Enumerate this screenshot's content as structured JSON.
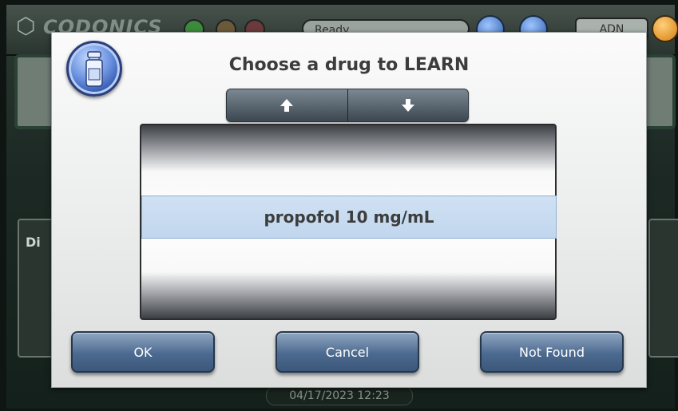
{
  "background": {
    "logo": "CODONICS",
    "status": "Ready",
    "user": "ADN",
    "panel_label": "Di",
    "datetime": "04/17/2023 12:23"
  },
  "dialog": {
    "icon": "vial-icon",
    "title": "Choose a drug to LEARN",
    "scroll_up_label": "🡑",
    "scroll_down_label": "🡓",
    "items": [
      "",
      "propofol 10 mg/mL",
      ""
    ],
    "selected_item": "propofol 10 mg/mL",
    "buttons": {
      "ok": "OK",
      "cancel": "Cancel",
      "not_found": "Not Found"
    }
  },
  "colors": {
    "button": "#4c6a90",
    "selection": "#c8dcf0",
    "title": "#3c3c3c"
  }
}
